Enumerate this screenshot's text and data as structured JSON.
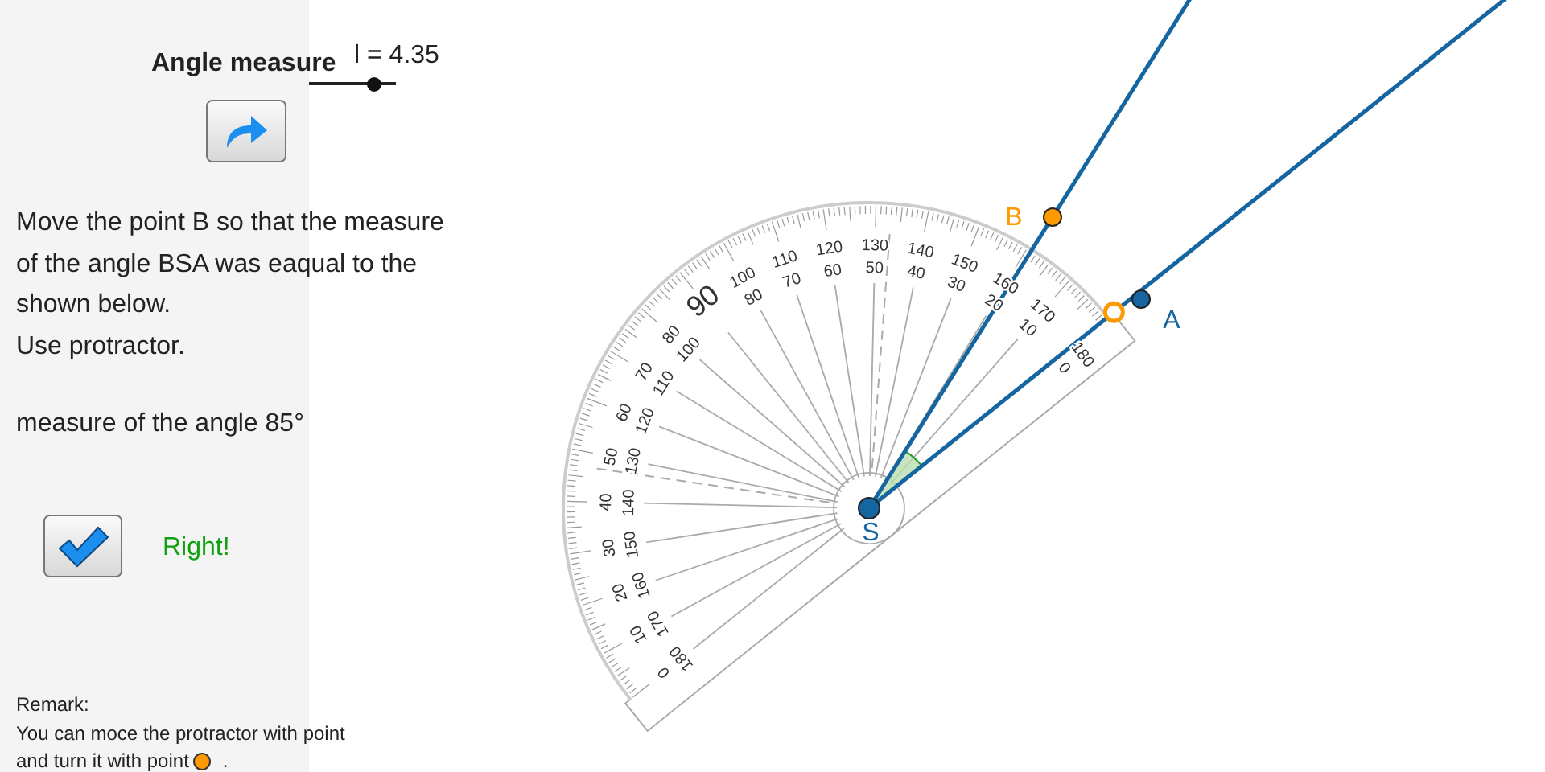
{
  "title": "Angle measure",
  "slider": {
    "label": "l = 4.35",
    "level": 0.75
  },
  "instructions": "Move the point B so that the measure\nof the angle BSA was eaqual to the\nshown below.\nUse protractor.",
  "target": "measure of the angle 85°",
  "result": {
    "text": "Right!",
    "correct": true
  },
  "remark": {
    "title": "Remark:",
    "lines": [
      "You can moce the protractor with point",
      "and turn it with point"
    ],
    "period": "."
  },
  "protractor": {
    "scale": [
      {
        "outer": "180",
        "inner": "0"
      },
      {
        "outer": "170",
        "inner": "10"
      },
      {
        "outer": "160",
        "inner": "20"
      },
      {
        "outer": "150",
        "inner": "30"
      },
      {
        "outer": "140",
        "inner": "40"
      },
      {
        "outer": "130",
        "inner": "50"
      },
      {
        "outer": "120",
        "inner": "60"
      },
      {
        "outer": "110",
        "inner": "70"
      },
      {
        "outer": "100",
        "inner": "80"
      },
      {
        "outer": "90"
      },
      {
        "outer": "80",
        "inner": "100"
      },
      {
        "outer": "70",
        "inner": "110"
      },
      {
        "outer": "60",
        "inner": "120"
      },
      {
        "outer": "50",
        "inner": "130"
      },
      {
        "outer": "40",
        "inner": "140"
      },
      {
        "outer": "30",
        "inner": "150"
      },
      {
        "outer": "20",
        "inner": "160"
      },
      {
        "outer": "10",
        "inner": "170"
      },
      {
        "outer": "0",
        "inner": "180"
      }
    ]
  },
  "points": [
    {
      "kind": "b",
      "label": "B",
      "color": "#ff9900"
    },
    {
      "kind": "a",
      "label": "A",
      "color": "#1565a0"
    },
    {
      "kind": "s",
      "label": "S",
      "color": "#1565a0"
    }
  ]
}
